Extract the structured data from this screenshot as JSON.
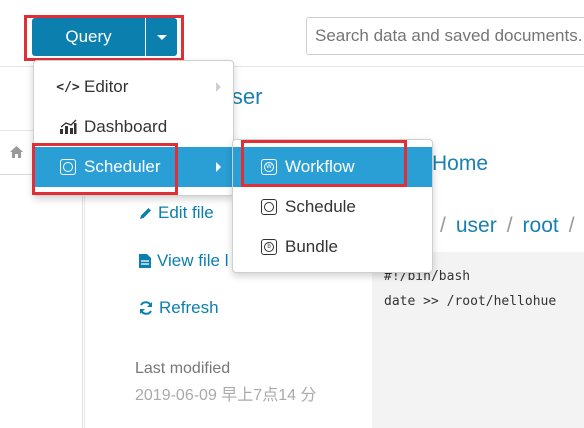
{
  "topbar": {
    "query_label": "Query",
    "search_placeholder": "Search data and saved documents..."
  },
  "page": {
    "browser_title_fragment": "wser",
    "home_link": "Home",
    "breadcrumb": [
      "user",
      "root"
    ],
    "code_lines": [
      "#!/bin/bash",
      "date >> /root/hellohue"
    ]
  },
  "actions": {
    "edit_file": "Edit file",
    "view_file": "View file l",
    "refresh": "Refresh",
    "last_modified_label": "Last modified",
    "last_modified_value": "2019-06-09 早上7点14 分"
  },
  "menu_main": {
    "items": [
      {
        "label": "Editor",
        "icon": "code-icon"
      },
      {
        "label": "Dashboard",
        "icon": "chart-icon"
      },
      {
        "label": "Scheduler",
        "icon": "scheduler-icon"
      }
    ]
  },
  "menu_sub": {
    "items": [
      {
        "label": "Workflow",
        "icon": "workflow-icon"
      },
      {
        "label": "Schedule",
        "icon": "schedule-icon"
      },
      {
        "label": "Bundle",
        "icon": "bundle-icon"
      }
    ]
  },
  "colors": {
    "primary": "#0b7fad",
    "menu_active": "#2a9fd6",
    "highlight_box": "#e02f36",
    "link": "#1b7fb0"
  }
}
